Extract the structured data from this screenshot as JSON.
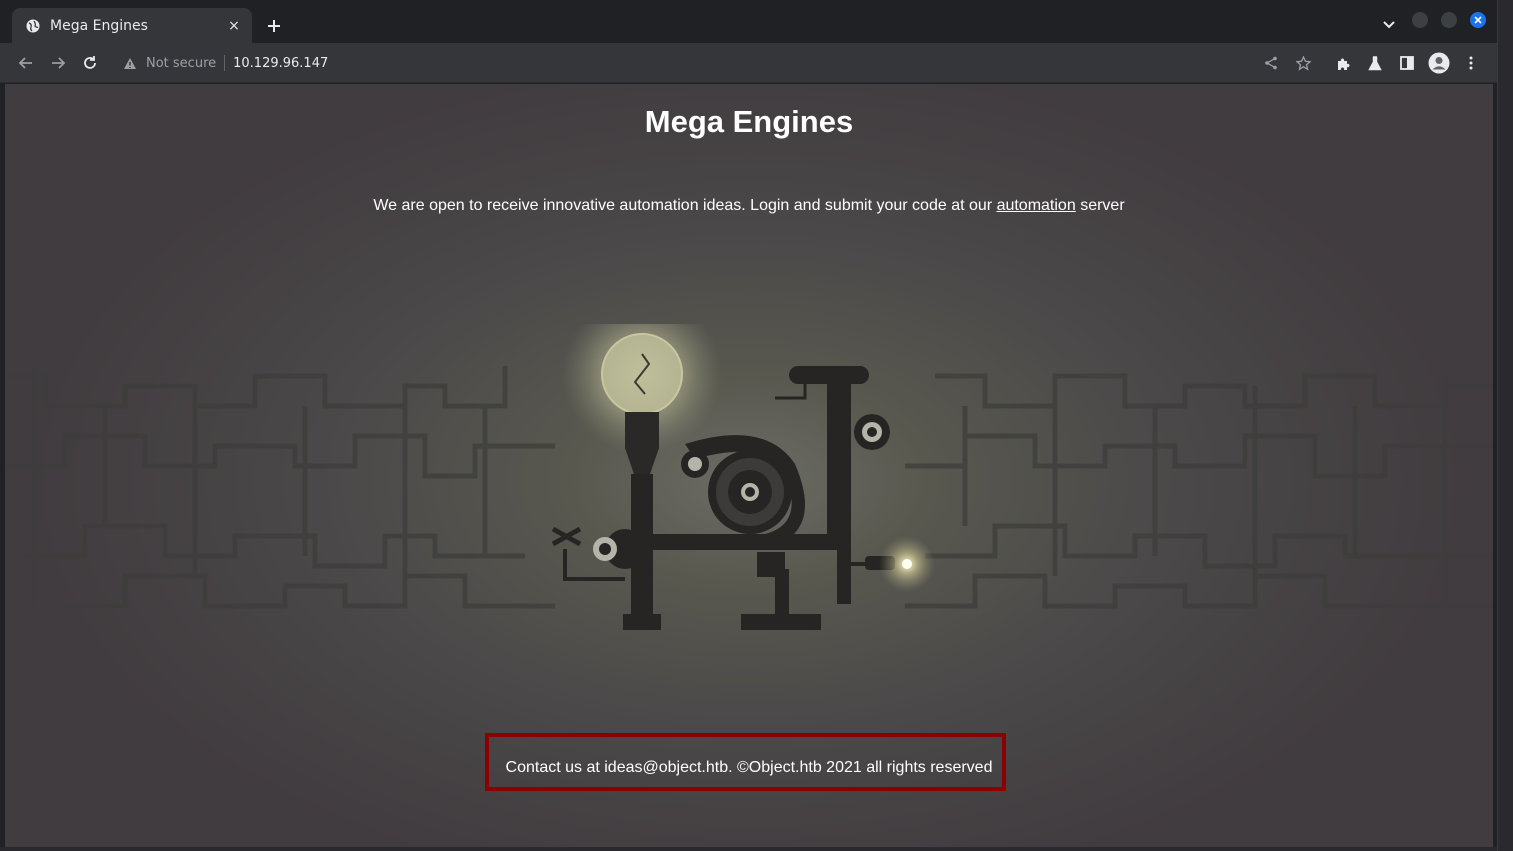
{
  "browser": {
    "tab_title": "Mega Engines",
    "close_glyph": "×",
    "new_tab_glyph": "+",
    "security_label": "Not secure",
    "url": "10.129.96.147",
    "icons": [
      "globe-icon",
      "close-icon",
      "plus-icon",
      "chevron-down-icon",
      "back-icon",
      "forward-icon",
      "reload-icon",
      "warning-icon",
      "share-icon",
      "star-icon",
      "puzzle-icon",
      "flask-icon",
      "sidepanel-icon",
      "profile-icon",
      "kebab-menu-icon"
    ],
    "window_buttons": {
      "min_color": "#3c4043",
      "max_color": "#3c4043",
      "close_color": "#1a73e8"
    }
  },
  "page": {
    "title": "Mega Engines",
    "intro_text": "We are open to receive innovative automation ideas. Login and submit your code at our",
    "intro_link": "automation",
    "intro_suffix": "server",
    "footer": "Contact us at ideas@object.htb. ©Object.htb 2021 all rights reserved",
    "highlight_color": "#8b0000"
  }
}
